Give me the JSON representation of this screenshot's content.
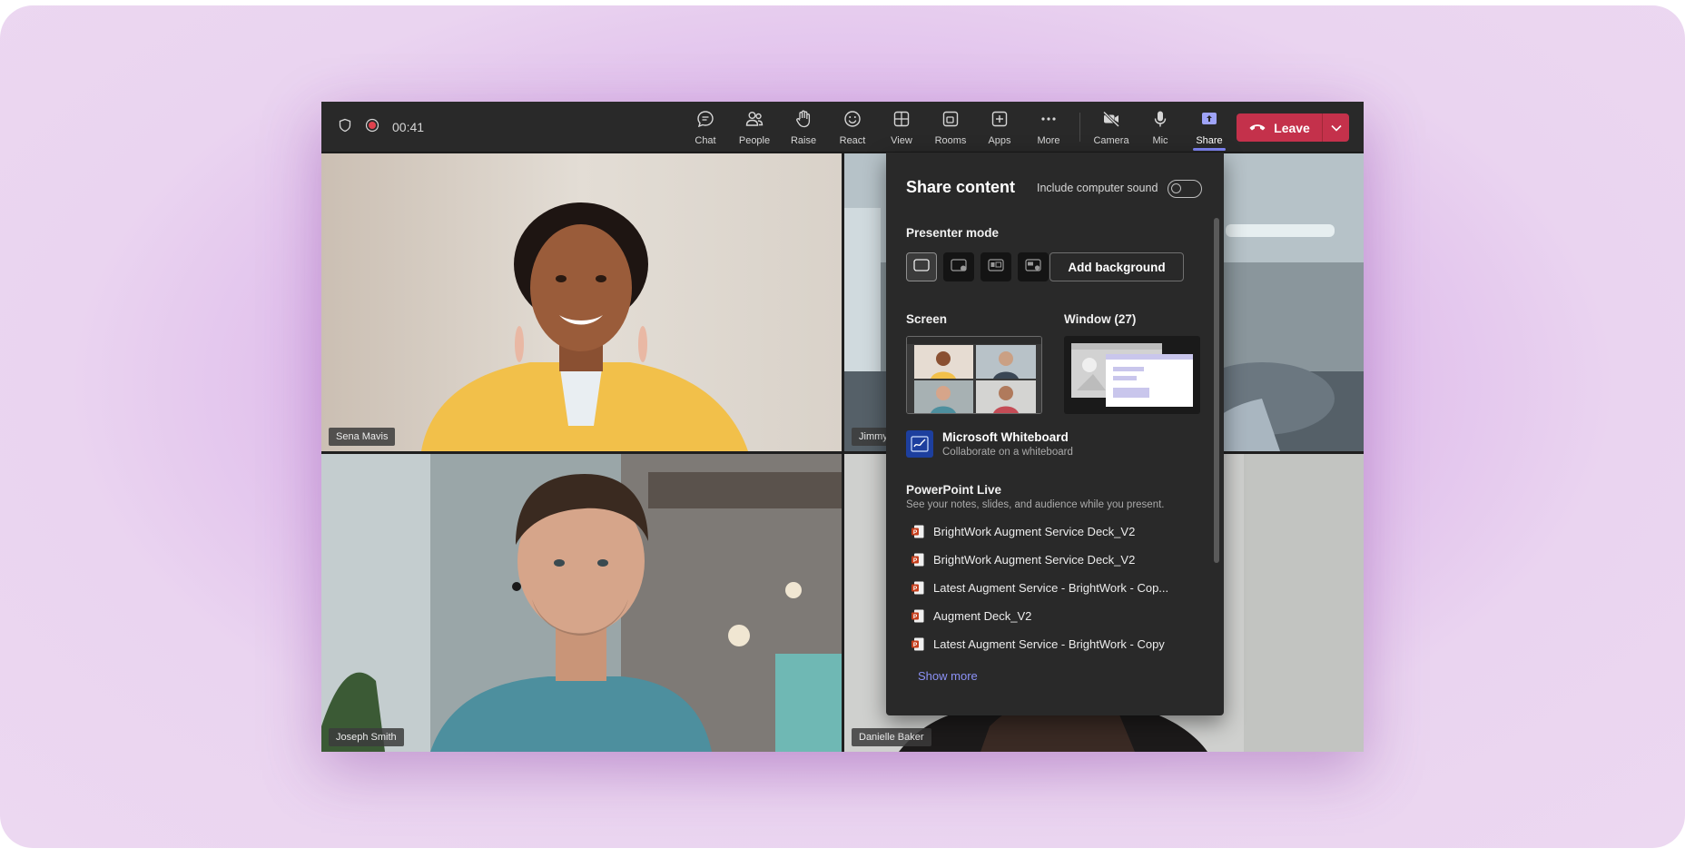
{
  "meeting": {
    "timer": "00:41"
  },
  "toolbar": {
    "items": [
      {
        "label": "Chat",
        "icon": "chat-icon"
      },
      {
        "label": "People",
        "icon": "people-icon"
      },
      {
        "label": "Raise",
        "icon": "raise-hand-icon"
      },
      {
        "label": "React",
        "icon": "react-icon"
      },
      {
        "label": "View",
        "icon": "view-icon"
      },
      {
        "label": "Rooms",
        "icon": "rooms-icon"
      },
      {
        "label": "Apps",
        "icon": "apps-icon"
      },
      {
        "label": "More",
        "icon": "more-icon"
      },
      {
        "label": "Camera",
        "icon": "camera-off-icon"
      },
      {
        "label": "Mic",
        "icon": "mic-icon"
      },
      {
        "label": "Share",
        "icon": "share-icon",
        "active": true
      }
    ],
    "leave_label": "Leave"
  },
  "participants": [
    {
      "name": "Sena Mavis"
    },
    {
      "name": "Jimmy"
    },
    {
      "name": "Joseph Smith"
    },
    {
      "name": "Danielle Baker"
    }
  ],
  "share_panel": {
    "title": "Share content",
    "computer_sound_label": "Include computer sound",
    "computer_sound_on": false,
    "presenter_mode_label": "Presenter mode",
    "add_background_label": "Add background",
    "screen_label": "Screen",
    "window_label": "Window (27)",
    "whiteboard": {
      "title": "Microsoft Whiteboard",
      "subtitle": "Collaborate on a whiteboard"
    },
    "powerpoint": {
      "title": "PowerPoint Live",
      "subtitle": "See your notes, slides, and audience while you present.",
      "files": [
        "BrightWork Augment Service Deck_V2",
        "BrightWork Augment Service Deck_V2",
        "Latest Augment Service - BrightWork - Cop...",
        "Augment Deck_V2",
        "Latest Augment Service - BrightWork - Copy"
      ],
      "show_more_label": "Show more"
    }
  },
  "colors": {
    "accent": "#7f85f5",
    "leave": "#c4314b",
    "panel": "#292929"
  }
}
